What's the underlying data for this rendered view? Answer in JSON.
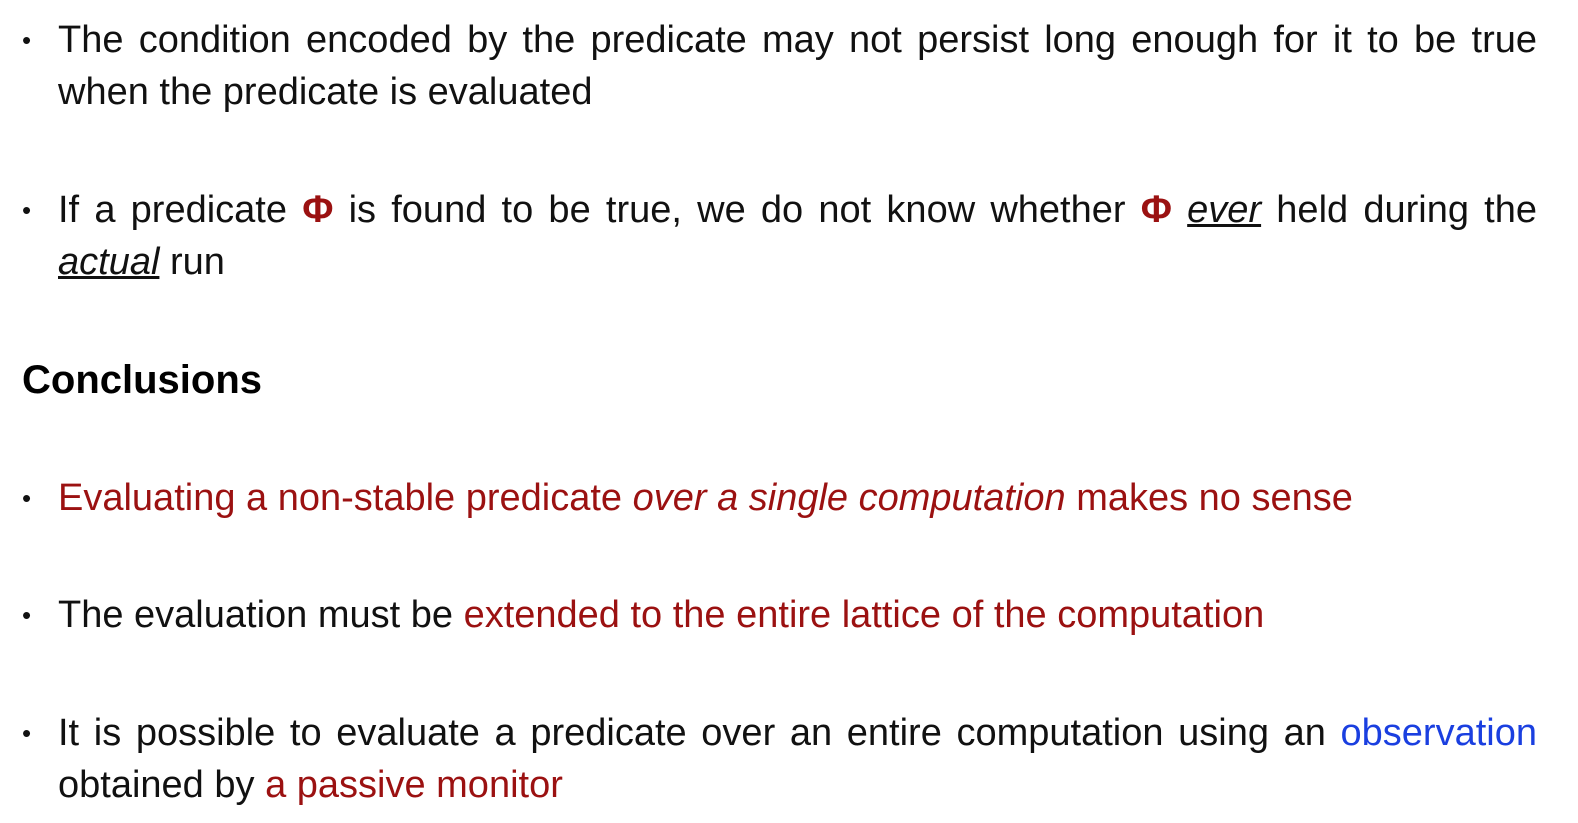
{
  "bullets_top": [
    {
      "text": "The condition encoded by the predicate may not persist long enough for it to be true when the predicate is evaluated"
    },
    {
      "part1": "If a predicate ",
      "phi1": "Φ",
      "part2": " is found to be true, we do not know whether ",
      "phi2": "Φ",
      "part3": " ",
      "ever": "ever",
      "part4": " held during the ",
      "actual": "actual",
      "part5": " run"
    }
  ],
  "heading": "Conclusions",
  "conclusions": [
    {
      "part1": "Evaluating a non-stable predicate ",
      "italic": "over a single computation",
      "part2": " makes no sense"
    },
    {
      "part1": "The evaluation must be ",
      "red": "extended to the entire lattice of the computation"
    },
    {
      "part1": "It is possible to evaluate a predicate over an entire computation using an ",
      "blue": "observation",
      "part2": " obtained by ",
      "red": "a passive monitor"
    }
  ],
  "bullet_glyph": "•",
  "colors": {
    "accent_red": "#9b1111",
    "accent_blue": "#1a3fe0",
    "text": "#111111"
  }
}
